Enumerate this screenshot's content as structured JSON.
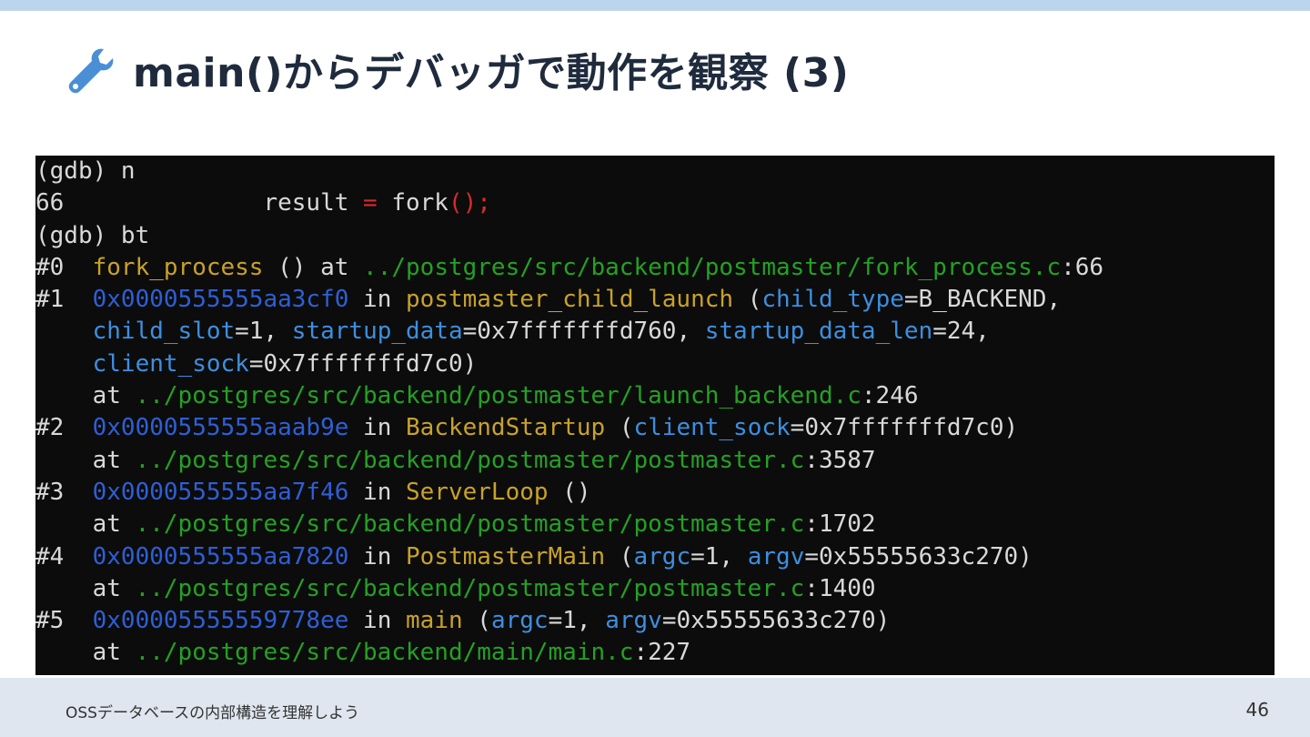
{
  "slide": {
    "title": "main()からデバッガで動作を観察 (3)",
    "icon": "wrench-icon",
    "accent_color": "#bcd5ee"
  },
  "terminal": {
    "colors": {
      "background": "#0c0c0c",
      "text": "#d9d9d9",
      "function": "#c9a227",
      "path": "#24a124",
      "address": "#2e5fd6",
      "argument": "#3c8fe0",
      "operator": "#d92b2b"
    },
    "lines": [
      [
        {
          "t": "(gdb) n",
          "c": ""
        }
      ],
      [
        {
          "t": "66              result ",
          "c": ""
        },
        {
          "t": "=",
          "c": "red"
        },
        {
          "t": " fork",
          "c": ""
        },
        {
          "t": "();",
          "c": "red"
        }
      ],
      [
        {
          "t": "(gdb) bt",
          "c": ""
        }
      ],
      [
        {
          "t": "#0  ",
          "c": ""
        },
        {
          "t": "fork_process",
          "c": "fn"
        },
        {
          "t": " () at ",
          "c": ""
        },
        {
          "t": "../postgres/src/backend/postmaster/fork_process.c",
          "c": "path"
        },
        {
          "t": ":66",
          "c": ""
        }
      ],
      [
        {
          "t": "#1  ",
          "c": ""
        },
        {
          "t": "0x0000555555aa3cf0",
          "c": "addr"
        },
        {
          "t": " in ",
          "c": ""
        },
        {
          "t": "postmaster_child_launch",
          "c": "fn"
        },
        {
          "t": " (",
          "c": ""
        },
        {
          "t": "child_type",
          "c": "arg"
        },
        {
          "t": "=B_BACKEND,",
          "c": ""
        }
      ],
      [
        {
          "t": "    ",
          "c": ""
        },
        {
          "t": "child_slot",
          "c": "arg"
        },
        {
          "t": "=1, ",
          "c": ""
        },
        {
          "t": "startup_data",
          "c": "arg"
        },
        {
          "t": "=0x7fffffffd760, ",
          "c": ""
        },
        {
          "t": "startup_data_len",
          "c": "arg"
        },
        {
          "t": "=24,",
          "c": ""
        }
      ],
      [
        {
          "t": "    ",
          "c": ""
        },
        {
          "t": "client_sock",
          "c": "arg"
        },
        {
          "t": "=0x7fffffffd7c0)",
          "c": ""
        }
      ],
      [
        {
          "t": "    at ",
          "c": ""
        },
        {
          "t": "../postgres/src/backend/postmaster/launch_backend.c",
          "c": "path"
        },
        {
          "t": ":246",
          "c": ""
        }
      ],
      [
        {
          "t": "#2  ",
          "c": ""
        },
        {
          "t": "0x0000555555aaab9e",
          "c": "addr"
        },
        {
          "t": " in ",
          "c": ""
        },
        {
          "t": "BackendStartup",
          "c": "fn"
        },
        {
          "t": " (",
          "c": ""
        },
        {
          "t": "client_sock",
          "c": "arg"
        },
        {
          "t": "=0x7fffffffd7c0)",
          "c": ""
        }
      ],
      [
        {
          "t": "    at ",
          "c": ""
        },
        {
          "t": "../postgres/src/backend/postmaster/postmaster.c",
          "c": "path"
        },
        {
          "t": ":3587",
          "c": ""
        }
      ],
      [
        {
          "t": "#3  ",
          "c": ""
        },
        {
          "t": "0x0000555555aa7f46",
          "c": "addr"
        },
        {
          "t": " in ",
          "c": ""
        },
        {
          "t": "ServerLoop",
          "c": "fn"
        },
        {
          "t": " ()",
          "c": ""
        }
      ],
      [
        {
          "t": "    at ",
          "c": ""
        },
        {
          "t": "../postgres/src/backend/postmaster/postmaster.c",
          "c": "path"
        },
        {
          "t": ":1702",
          "c": ""
        }
      ],
      [
        {
          "t": "#4  ",
          "c": ""
        },
        {
          "t": "0x0000555555aa7820",
          "c": "addr"
        },
        {
          "t": " in ",
          "c": ""
        },
        {
          "t": "PostmasterMain",
          "c": "fn"
        },
        {
          "t": " (",
          "c": ""
        },
        {
          "t": "argc",
          "c": "arg"
        },
        {
          "t": "=1, ",
          "c": ""
        },
        {
          "t": "argv",
          "c": "arg"
        },
        {
          "t": "=0x55555633c270)",
          "c": ""
        }
      ],
      [
        {
          "t": "    at ",
          "c": ""
        },
        {
          "t": "../postgres/src/backend/postmaster/postmaster.c",
          "c": "path"
        },
        {
          "t": ":1400",
          "c": ""
        }
      ],
      [
        {
          "t": "#5  ",
          "c": ""
        },
        {
          "t": "0x00005555559778ee",
          "c": "addr"
        },
        {
          "t": " in ",
          "c": ""
        },
        {
          "t": "main",
          "c": "fn"
        },
        {
          "t": " (",
          "c": ""
        },
        {
          "t": "argc",
          "c": "arg"
        },
        {
          "t": "=1, ",
          "c": ""
        },
        {
          "t": "argv",
          "c": "arg"
        },
        {
          "t": "=0x55555633c270)",
          "c": ""
        }
      ],
      [
        {
          "t": "    at ",
          "c": ""
        },
        {
          "t": "../postgres/src/backend/main/main.c",
          "c": "path"
        },
        {
          "t": ":227",
          "c": ""
        }
      ]
    ]
  },
  "footer": {
    "text": "OSSデータベースの内部構造を理解しよう",
    "page_number": "46"
  }
}
